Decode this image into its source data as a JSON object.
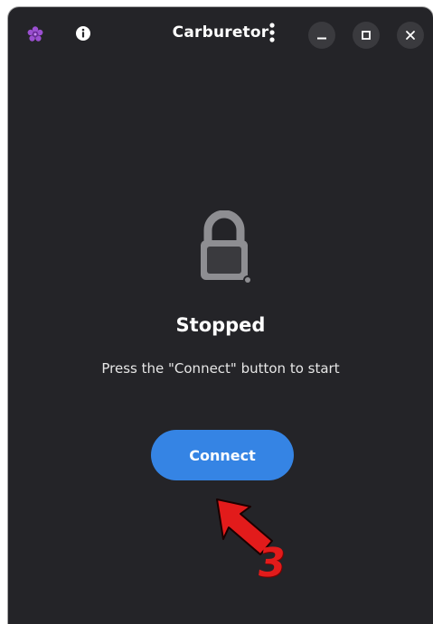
{
  "window": {
    "title": "Carburetor"
  },
  "titlebar": {
    "app_icon": "carburetor-flower-icon",
    "info_icon": "info-icon",
    "menu_icon": "vertical-ellipsis-icon",
    "controls": {
      "minimize_icon": "minimize-icon",
      "maximize_icon": "maximize-icon",
      "close_icon": "close-icon"
    }
  },
  "status": {
    "icon": "lock-icon",
    "title": "Stopped",
    "description": "Press the \"Connect\" button to start"
  },
  "actions": {
    "connect_label": "Connect"
  },
  "annotation": {
    "number": "3",
    "arrow_icon": "red-arrow-icon"
  },
  "colors": {
    "window_bg": "#242428",
    "button_accent": "#3584e4",
    "annotation": "#e21b1b",
    "icon_gray": "#8e8e92",
    "app_icon_purple": "#9b4fd1"
  }
}
